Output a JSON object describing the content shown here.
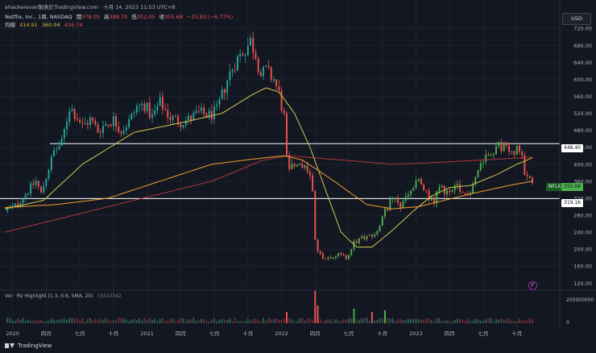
{
  "header": {
    "credit": "ehackerevan製表於TradingView.com · 十月 14, 2023 11:53 UTC+8",
    "symbol": "Netflix, Inc., 1周, NASDAQ",
    "open_label": "開",
    "open": "378.05",
    "high_label": "高",
    "high": "388.70",
    "low_label": "低",
    "low": "352.05",
    "close_label": "收",
    "close": "355.68",
    "change": "−25.83 (−6.77%)",
    "ma_label": "均線",
    "ma1": "414.91",
    "ma2": "360.04",
    "ma3": "416.74"
  },
  "currency": "USD",
  "price_tag": {
    "symbol": "NFLX",
    "value": "355.68"
  },
  "level_tags": {
    "upper": "448.40",
    "lower": "319.16"
  },
  "volume": {
    "label": "Vol · RV Highlight (1.3, 0.6, SMA, 20)",
    "value": "33432542",
    "axis_top": "200000000",
    "axis_zero": "0"
  },
  "footer": {
    "brand": "TradingView"
  },
  "badge": "F",
  "colors": {
    "up": "#26a69a",
    "up_alt": "#4caf50",
    "down": "#ef5350",
    "ma_red": "#b2393c",
    "ma_yellow": "#d4c84a",
    "ma_orange": "#f0a030",
    "hline": "#ffffff"
  },
  "chart_data": {
    "type": "candlestick",
    "title": "Netflix, Inc., 1周, NASDAQ",
    "y_ticks": [
      120,
      160,
      200,
      240,
      280,
      320,
      360,
      400,
      440,
      480,
      520,
      560,
      600,
      640,
      680,
      720
    ],
    "ylim": [
      111,
      728
    ],
    "x_tick_labels": [
      {
        "label": "2020",
        "week": 3
      },
      {
        "label": "四月",
        "week": 16
      },
      {
        "label": "七月",
        "week": 29
      },
      {
        "label": "十月",
        "week": 42
      },
      {
        "label": "2021",
        "week": 55
      },
      {
        "label": "四月",
        "week": 68
      },
      {
        "label": "七月",
        "week": 81
      },
      {
        "label": "十月",
        "week": 94
      },
      {
        "label": "2022",
        "week": 107
      },
      {
        "label": "四月",
        "week": 120
      },
      {
        "label": "七月",
        "week": 133
      },
      {
        "label": "十月",
        "week": 146
      },
      {
        "label": "2023",
        "week": 159
      },
      {
        "label": "四月",
        "week": 172
      },
      {
        "label": "七月",
        "week": 185
      },
      {
        "label": "十月",
        "week": 198
      }
    ],
    "horizontal_lines": [
      448.4,
      319.16
    ],
    "close_keypoints": [
      [
        0,
        290
      ],
      [
        4,
        302
      ],
      [
        8,
        330
      ],
      [
        12,
        360
      ],
      [
        14,
        330
      ],
      [
        16,
        372
      ],
      [
        19,
        430
      ],
      [
        22,
        450
      ],
      [
        25,
        535
      ],
      [
        27,
        520
      ],
      [
        30,
        490
      ],
      [
        33,
        505
      ],
      [
        36,
        480
      ],
      [
        39,
        495
      ],
      [
        42,
        505
      ],
      [
        45,
        480
      ],
      [
        48,
        500
      ],
      [
        51,
        535
      ],
      [
        54,
        540
      ],
      [
        57,
        510
      ],
      [
        60,
        545
      ],
      [
        64,
        510
      ],
      [
        68,
        500
      ],
      [
        71,
        505
      ],
      [
        75,
        520
      ],
      [
        79,
        515
      ],
      [
        82,
        525
      ],
      [
        86,
        600
      ],
      [
        89,
        640
      ],
      [
        92,
        665
      ],
      [
        94,
        680
      ],
      [
        95,
        690
      ],
      [
        97,
        660
      ],
      [
        99,
        610
      ],
      [
        101,
        620
      ],
      [
        104,
        600
      ],
      [
        106,
        565
      ],
      [
        108,
        510
      ],
      [
        109,
        410
      ],
      [
        110,
        390
      ],
      [
        113,
        390
      ],
      [
        116,
        400
      ],
      [
        118,
        370
      ],
      [
        119,
        340
      ],
      [
        120,
        225
      ],
      [
        121,
        190
      ],
      [
        124,
        178
      ],
      [
        128,
        188
      ],
      [
        132,
        180
      ],
      [
        135,
        215
      ],
      [
        138,
        225
      ],
      [
        141,
        230
      ],
      [
        144,
        240
      ],
      [
        147,
        290
      ],
      [
        150,
        320
      ],
      [
        153,
        300
      ],
      [
        156,
        330
      ],
      [
        160,
        360
      ],
      [
        163,
        330
      ],
      [
        166,
        310
      ],
      [
        168,
        345
      ],
      [
        172,
        330
      ],
      [
        175,
        345
      ],
      [
        177,
        325
      ],
      [
        180,
        340
      ],
      [
        184,
        400
      ],
      [
        187,
        430
      ],
      [
        190,
        440
      ],
      [
        193,
        445
      ],
      [
        195,
        425
      ],
      [
        197,
        435
      ],
      [
        199,
        440
      ],
      [
        201,
        385
      ],
      [
        203,
        378
      ],
      [
        204,
        355.68
      ]
    ],
    "series": [
      {
        "name": "",
        "color": "#b2393c",
        "points": [
          [
            0,
            240
          ],
          [
            40,
            300
          ],
          [
            80,
            360
          ],
          [
            100,
            410
          ],
          [
            110,
            420
          ],
          [
            130,
            410
          ],
          [
            150,
            400
          ],
          [
            170,
            405
          ],
          [
            204,
            416.74
          ]
        ]
      },
      {
        "name": "",
        "color": "#d4c84a",
        "points": [
          [
            0,
            295
          ],
          [
            15,
            315
          ],
          [
            30,
            400
          ],
          [
            50,
            475
          ],
          [
            70,
            500
          ],
          [
            84,
            520
          ],
          [
            96,
            565
          ],
          [
            101,
            580
          ],
          [
            106,
            570
          ],
          [
            112,
            520
          ],
          [
            118,
            440
          ],
          [
            124,
            340
          ],
          [
            130,
            240
          ],
          [
            136,
            205
          ],
          [
            142,
            205
          ],
          [
            150,
            245
          ],
          [
            158,
            290
          ],
          [
            165,
            325
          ],
          [
            172,
            345
          ],
          [
            180,
            350
          ],
          [
            190,
            375
          ],
          [
            198,
            400
          ],
          [
            204,
            414.91
          ]
        ]
      },
      {
        "name": "",
        "color": "#f0a030",
        "points": [
          [
            0,
            298
          ],
          [
            20,
            305
          ],
          [
            40,
            320
          ],
          [
            60,
            360
          ],
          [
            80,
            400
          ],
          [
            100,
            415
          ],
          [
            108,
            420
          ],
          [
            115,
            410
          ],
          [
            125,
            370
          ],
          [
            140,
            305
          ],
          [
            150,
            295
          ],
          [
            160,
            300
          ],
          [
            180,
            330
          ],
          [
            195,
            350
          ],
          [
            204,
            360.04
          ]
        ]
      }
    ],
    "volume_axis_top": 200000000
  }
}
